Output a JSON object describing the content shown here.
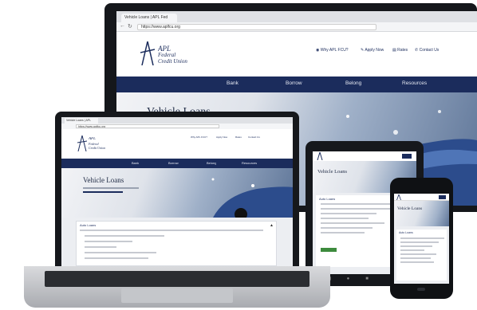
{
  "monitor": {
    "tab_title": "Vehicle Loans | APL Fed",
    "url": "https://www.aplfcu.org",
    "top_links": [
      "Why APL FCU?",
      "Apply Now",
      "Rates",
      "Contact Us"
    ],
    "logo": {
      "line1": "APL",
      "line2": "Federal",
      "line3": "Credit Union"
    },
    "nav": [
      "Bank",
      "Borrow",
      "Belong",
      "Resources"
    ],
    "hero_title": "Vehicle Loans"
  },
  "laptop": {
    "tab_title": "Vehicle Loans | APL",
    "url": "https://www.aplfcu.org",
    "top_links": [
      "Why APL FCU?",
      "Apply Now",
      "Rates",
      "Contact Us"
    ],
    "logo": {
      "line1": "APL",
      "line2": "Federal",
      "line3": "Credit Union"
    },
    "nav": [
      "Bank",
      "Borrow",
      "Belong",
      "Resources"
    ],
    "hero_title": "Vehicle Loans",
    "panel_title": "Auto Loans"
  },
  "tablet": {
    "hero_title": "Vehicle Loans",
    "panel_title": "Auto Loans"
  },
  "phone": {
    "hero_title": "Vehicle Loans",
    "panel_title": "Auto Loans"
  },
  "colors": {
    "nav_bg": "#1b2c5c",
    "hero_title": "#1f2a44",
    "apply_button": "#3d8b3d",
    "device_frame": "#15171b"
  },
  "icons": [
    "globe-icon",
    "pencil-icon",
    "document-icon",
    "phone-icon",
    "sports-car-image"
  ]
}
